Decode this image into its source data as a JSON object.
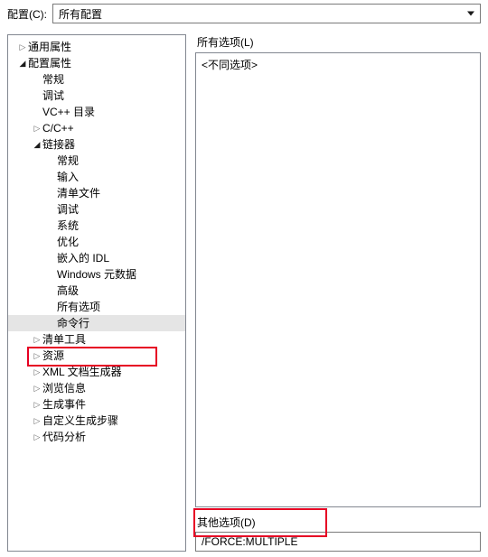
{
  "config": {
    "label": "配置(C):",
    "value": "所有配置"
  },
  "tree": {
    "common_props": "通用属性",
    "config_props": "配置属性",
    "general": "常规",
    "debug": "调试",
    "vcpp_dir": "VC++ 目录",
    "ccpp": "C/C++",
    "linker": "链接器",
    "linker_general": "常规",
    "linker_input": "输入",
    "linker_manifest": "清单文件",
    "linker_debug": "调试",
    "linker_system": "系统",
    "linker_opt": "优化",
    "linker_idl": "嵌入的 IDL",
    "linker_winmeta": "Windows 元数据",
    "linker_advanced": "高级",
    "linker_allopts": "所有选项",
    "linker_cmdline": "命令行",
    "manifest_tool": "清单工具",
    "resources": "资源",
    "xml_docgen": "XML 文档生成器",
    "browse_info": "浏览信息",
    "build_events": "生成事件",
    "custom_build": "自定义生成步骤",
    "code_analysis": "代码分析"
  },
  "right": {
    "all_options_label": "所有选项(L)",
    "all_options_value": "<不同选项>",
    "other_options_label": "其他选项(D)",
    "other_options_value": "/FORCE:MULTIPLE"
  },
  "glyphs": {
    "closed": "▷",
    "open": "◢"
  }
}
